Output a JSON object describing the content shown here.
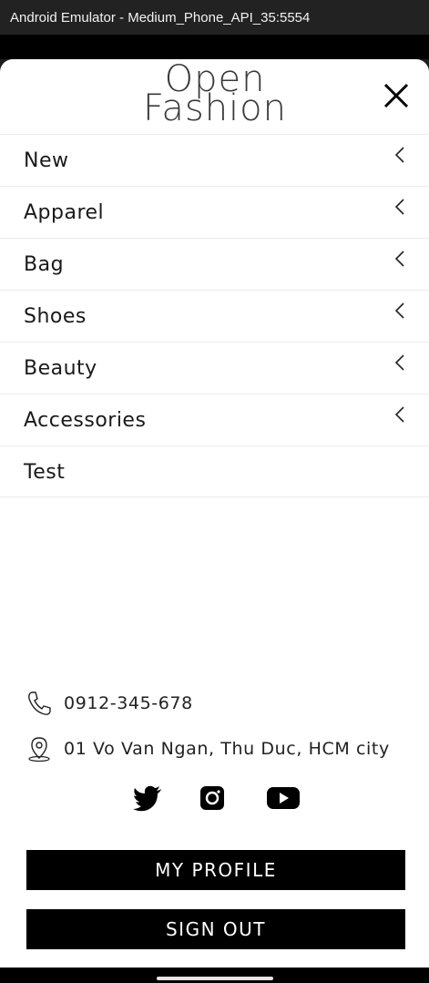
{
  "window": {
    "title": "Android Emulator - Medium_Phone_API_35:5554"
  },
  "header": {
    "logo_line1": "Open",
    "logo_line2": "Fashion"
  },
  "menu": {
    "items": [
      {
        "label": "New",
        "has_chevron": true
      },
      {
        "label": "Apparel",
        "has_chevron": true
      },
      {
        "label": "Bag",
        "has_chevron": true
      },
      {
        "label": "Shoes",
        "has_chevron": true
      },
      {
        "label": "Beauty",
        "has_chevron": true
      },
      {
        "label": "Accessories",
        "has_chevron": true
      },
      {
        "label": "Test",
        "has_chevron": false
      }
    ]
  },
  "contact": {
    "phone": "0912-345-678",
    "address": "01 Vo Van Ngan, Thu Duc, HCM city"
  },
  "socials": [
    "twitter-icon",
    "instagram-icon",
    "youtube-icon"
  ],
  "buttons": {
    "profile": "MY PROFILE",
    "signout": "SIGN OUT"
  }
}
